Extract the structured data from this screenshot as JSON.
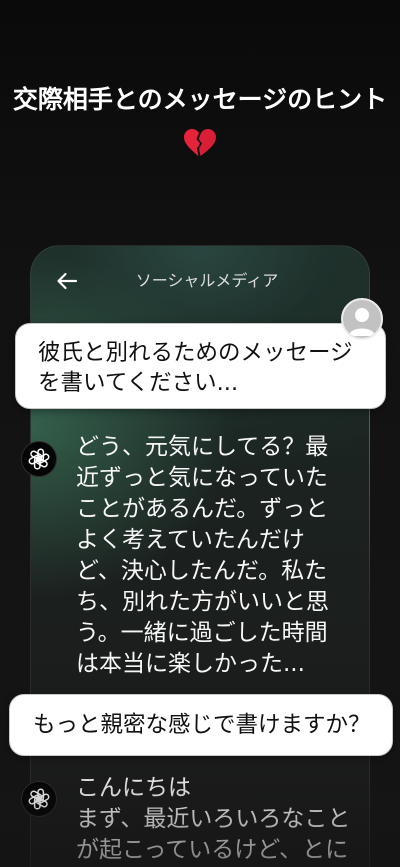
{
  "headline": "交際相手とのメッセージのヒント",
  "icons": {
    "headline": "broken-heart-icon",
    "back": "back-arrow-icon",
    "user_avatar": "user-avatar-icon",
    "assistant_avatar": "openai-logo-icon"
  },
  "colors": {
    "page_background": "#121212",
    "card_glow": "#488e6e",
    "bubble_background": "#ffffff",
    "bubble_text": "#111111",
    "reply_text": "#ffffff",
    "heart": "#e5243b"
  },
  "phone": {
    "title": "ソーシャルメディア",
    "conversation": [
      {
        "prompt": [
          "彼氏と別れるためのメッセージ",
          "を書いてください..."
        ]
      },
      {
        "reply": [
          "どう、元気にしてる？最",
          "近ずっと気になっていた",
          "ことがあるんだ。ずっと",
          "よく考えていたんだけ",
          "ど、決心したんだ。私た",
          "ち、別れた方がいいと思",
          "う。一緒に過ごした時間",
          "は本当に楽しかった..."
        ]
      },
      {
        "prompt": [
          "もっと親密な感じで書けますか？"
        ]
      },
      {
        "reply": [
          "こんにちは",
          "まず、最近いろいろなこと",
          "が起こっているけど、とに"
        ]
      }
    ]
  }
}
